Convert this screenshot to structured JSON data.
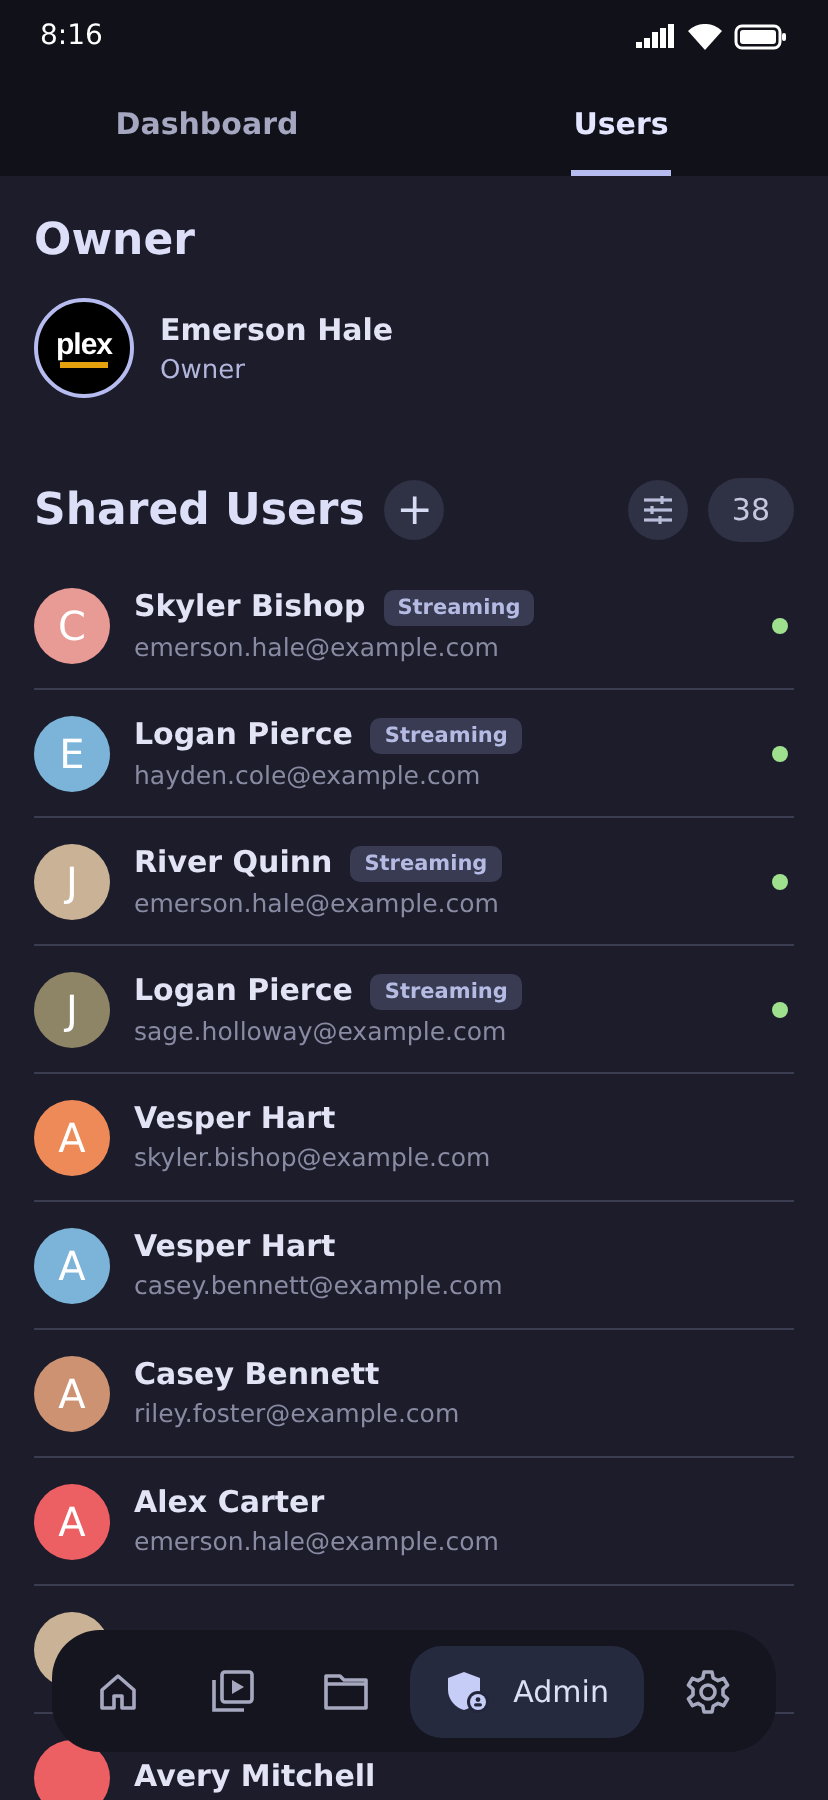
{
  "status_bar": {
    "time": "8:16"
  },
  "tabs": [
    {
      "label": "Dashboard",
      "selected": false
    },
    {
      "label": "Users",
      "selected": true
    }
  ],
  "owner_section": {
    "title": "Owner",
    "name": "Emerson Hale",
    "role": "Owner",
    "logo_text": "plex"
  },
  "shared_section": {
    "title": "Shared Users",
    "add_symbol": "+",
    "count": "38"
  },
  "users": [
    {
      "initial": "C",
      "color": "#e89a94",
      "name": "Skyler Bishop",
      "badge": "Streaming",
      "email": "emerson.hale@example.com",
      "online": true
    },
    {
      "initial": "E",
      "color": "#7cb3d9",
      "name": "Logan Pierce",
      "badge": "Streaming",
      "email": "hayden.cole@example.com",
      "online": true
    },
    {
      "initial": "J",
      "color": "#c9b296",
      "name": "River Quinn",
      "badge": "Streaming",
      "email": "emerson.hale@example.com",
      "online": true
    },
    {
      "initial": "J",
      "color": "#8e8466",
      "name": "Logan Pierce",
      "badge": "Streaming",
      "email": "sage.holloway@example.com",
      "online": true
    },
    {
      "initial": "A",
      "color": "#ee8a58",
      "name": "Vesper Hart",
      "email": "skyler.bishop@example.com",
      "online": false
    },
    {
      "initial": "A",
      "color": "#7cb3d9",
      "name": "Vesper Hart",
      "email": "casey.bennett@example.com",
      "online": false
    },
    {
      "initial": "A",
      "color": "#cc9272",
      "name": "Casey Bennett",
      "email": "riley.foster@example.com",
      "online": false
    },
    {
      "initial": "A",
      "color": "#ec5f63",
      "name": "Alex Carter",
      "email": "emerson.hale@example.com",
      "online": false
    },
    {
      "color": "#c9b296",
      "online": false
    },
    {
      "color": "#ec5f63",
      "name": "Avery Mitchell",
      "online": false
    }
  ],
  "bottom_nav": [
    {
      "kind": "home",
      "selected": false
    },
    {
      "kind": "media",
      "selected": false
    },
    {
      "kind": "folder",
      "selected": false
    },
    {
      "kind": "admin",
      "label": "Admin",
      "selected": true
    },
    {
      "kind": "settings",
      "selected": false
    }
  ]
}
